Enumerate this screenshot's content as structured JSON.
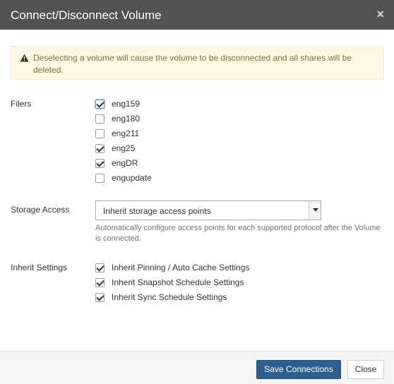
{
  "dialog": {
    "title": "Connect/Disconnect Volume",
    "close_glyph": "×"
  },
  "alert": {
    "icon": "warning-triangle-icon",
    "message": "Deselecting a volume will cause the volume to be disconnected and all shares will be deleted.",
    "background": "#fcf8e3",
    "text_color": "#8a6d3b"
  },
  "filers": {
    "label": "Filers",
    "items": [
      {
        "name": "eng159",
        "checked": true
      },
      {
        "name": "eng180",
        "checked": false
      },
      {
        "name": "eng211",
        "checked": false
      },
      {
        "name": "eng25",
        "checked": true
      },
      {
        "name": "engDR",
        "checked": true
      },
      {
        "name": "engupdate",
        "checked": false
      }
    ]
  },
  "storage_access": {
    "label": "Storage Access",
    "selected": "Inherit storage access points",
    "help": "Automatically configure access points for each supported protocol after the Volume is connected."
  },
  "inherit_settings": {
    "label": "Inherit Settings",
    "items": [
      {
        "name": "Inherit Pinning / Auto Cache Settings",
        "checked": true
      },
      {
        "name": "Inherit Snapshot Schedule Settings",
        "checked": true
      },
      {
        "name": "Inherit Sync Schedule Settings",
        "checked": true
      }
    ]
  },
  "footer": {
    "save_label": "Save Connections",
    "close_label": "Close",
    "primary_color": "#2e5f8e"
  }
}
